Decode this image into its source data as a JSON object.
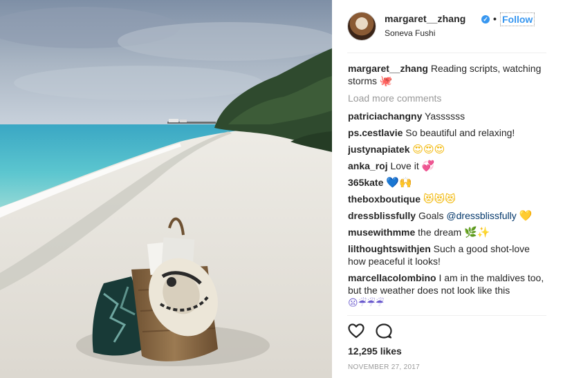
{
  "post": {
    "username": "margaret__zhang",
    "separator": "•",
    "follow_label": "Follow",
    "location": "Soneva Fushi",
    "caption_user": "margaret__zhang",
    "caption_text": "Reading scripts, watching storms",
    "caption_emoji": "🐙",
    "load_more_label": "Load more comments",
    "likes": "12,295 likes",
    "date": "NOVEMBER 27, 2017"
  },
  "comments": [
    {
      "user": "patriciachangny",
      "text": "Yassssss",
      "emoji": ""
    },
    {
      "user": "ps.cestlavie",
      "text": "So beautiful and relaxing!",
      "emoji": ""
    },
    {
      "user": "justynapiatek",
      "text": "",
      "emoji": "😍😍😍"
    },
    {
      "user": "anka_roj",
      "text": "Love it",
      "emoji": "💞"
    },
    {
      "user": "365kate",
      "text": "",
      "emoji": "💙🙌"
    },
    {
      "user": "theboxboutique",
      "text": "",
      "emoji": "😻😻😻"
    },
    {
      "user": "dressblissfully",
      "text": "Goals",
      "mention": "@dressblissfully",
      "emoji": "💛"
    },
    {
      "user": "musewithmme",
      "text": "the dream",
      "emoji": "🌿✨"
    },
    {
      "user": "lilthoughtswithjen",
      "text": "Such a good shot-love how peaceful it looks!",
      "emoji": ""
    },
    {
      "user": "marcellacolombino",
      "text": "I am in the maldives too, but the weather does not look like this",
      "emoji": "😦☔☔☔"
    }
  ],
  "colors": {
    "link_blue": "#3897f0",
    "mention_blue": "#003569",
    "muted_gray": "#999999",
    "text": "#262626"
  },
  "icons": {
    "like": "heart-icon",
    "comment": "comment-bubble-icon",
    "verified": "verified-badge-icon"
  }
}
